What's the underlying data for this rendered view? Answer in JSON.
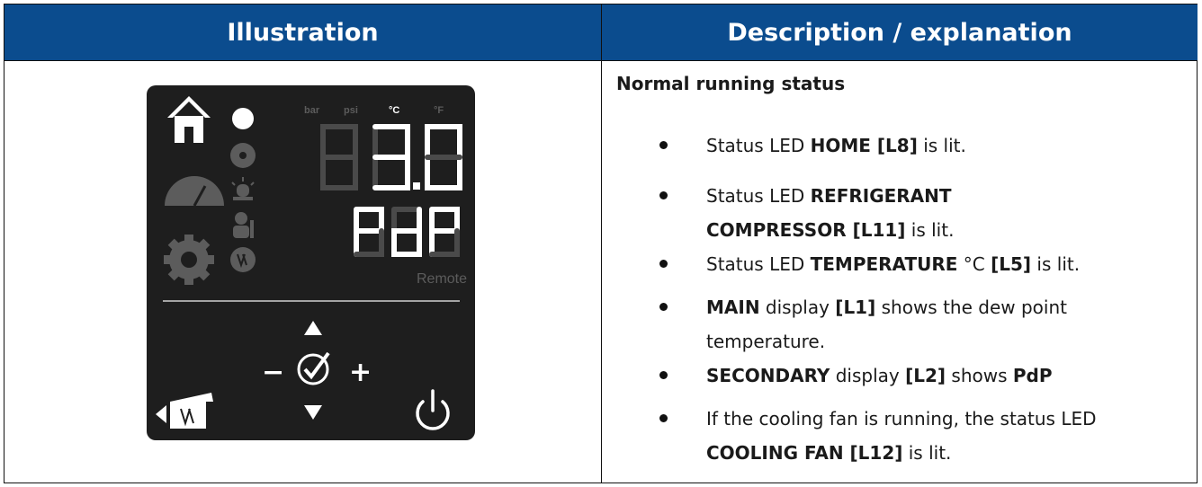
{
  "table": {
    "header_left": "Illustration",
    "header_right": "Description / explanation"
  },
  "panel": {
    "units": [
      "bar",
      "psi",
      "°C",
      "°F"
    ],
    "remote_label": "Remote",
    "minus_label": "−",
    "plus_label": "+",
    "main_display_digits": "8",
    "secondary_display": "PdP"
  },
  "description": {
    "title": "Normal running status",
    "items": [
      {
        "pre": "Status LED ",
        "b1": "HOME [L8]",
        "post": " is lit."
      },
      {
        "pre": "Status LED ",
        "b1": "REFRIGERANT",
        "line2b": "COMPRESSOR [L11]",
        "post": " is lit."
      },
      {
        "pre": "Status LED ",
        "b1": "TEMPERATURE",
        "mid": " °C ",
        "b2": "[L5]",
        "post": " is lit."
      },
      {
        "b1": "MAIN",
        "mid": " display ",
        "b2": "[L1]",
        "post": " shows the dew point",
        "line2": "temperature."
      },
      {
        "b1": "SECONDARY",
        "mid": " display ",
        "b2": "[L2]",
        "post": " shows ",
        "b3": "PdP"
      },
      {
        "pre": "If the cooling fan is running, the status LED",
        "line2b": "COOLING FAN [L12]",
        "post": " is lit."
      }
    ]
  }
}
